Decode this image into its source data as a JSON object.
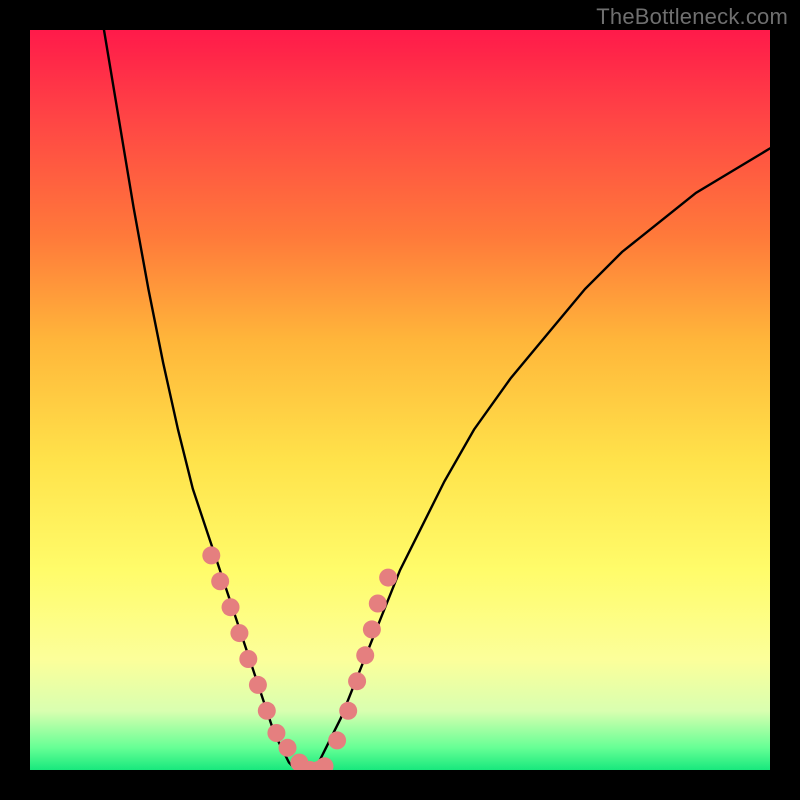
{
  "watermark": "TheBottleneck.com",
  "colors": {
    "page_bg": "#000000",
    "curve_stroke": "#000000",
    "marker_fill": "#e57f7f",
    "gradient": [
      "#ff1a4a",
      "#ff4545",
      "#ff7a3a",
      "#ffb63a",
      "#ffe24a",
      "#fffc6a",
      "#fcff9a",
      "#d9ffb0",
      "#66ff95",
      "#18e87d"
    ]
  },
  "chart_data": {
    "type": "line",
    "title": "",
    "xlabel": "",
    "ylabel": "",
    "xlim": [
      0,
      100
    ],
    "ylim": [
      0,
      100
    ],
    "grid": false,
    "legend": false,
    "series": [
      {
        "name": "bottleneck-curve",
        "x": [
          10,
          12,
          14,
          16,
          18,
          20,
          22,
          23,
          24,
          25,
          26,
          27,
          28,
          29,
          30,
          31,
          32,
          33,
          34,
          35,
          36,
          37,
          38,
          39,
          40,
          42,
          44,
          46,
          48,
          50,
          53,
          56,
          60,
          65,
          70,
          75,
          80,
          85,
          90,
          95,
          100
        ],
        "y": [
          100,
          88,
          76,
          65,
          55,
          46,
          38,
          35,
          32,
          29,
          26,
          23,
          20,
          17,
          14,
          11,
          8,
          5,
          3,
          1,
          0,
          0,
          0,
          1,
          3,
          7,
          12,
          17,
          22,
          27,
          33,
          39,
          46,
          53,
          59,
          65,
          70,
          74,
          78,
          81,
          84
        ]
      }
    ],
    "markers": {
      "name": "highlight-dots",
      "x": [
        24.5,
        25.7,
        27.1,
        28.3,
        29.5,
        30.8,
        32.0,
        33.3,
        34.8,
        36.4,
        37.8,
        39.0,
        39.8,
        41.5,
        43.0,
        44.2,
        45.3,
        46.2,
        47.0,
        48.4
      ],
      "y": [
        29,
        25.5,
        22,
        18.5,
        15,
        11.5,
        8,
        5,
        3,
        1,
        0,
        0,
        0.5,
        4,
        8,
        12,
        15.5,
        19,
        22.5,
        26
      ]
    }
  }
}
